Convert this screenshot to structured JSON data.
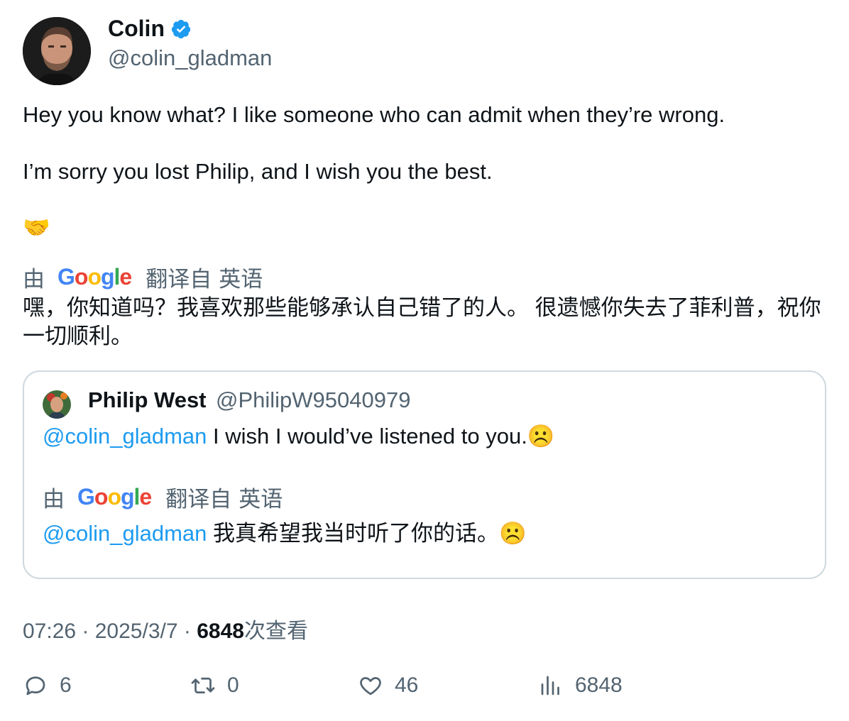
{
  "author": {
    "display_name": "Colin",
    "handle": "@colin_gladman",
    "verified": true
  },
  "tweet": {
    "text": "Hey you know what? I like someone who can admit when they’re wrong.\n\nI’m sorry you lost Philip, and I wish you the best.",
    "emoji": "🤝",
    "translation_prefix": "由",
    "translation_provider": "Google",
    "translation_label": "翻译自",
    "translation_language": "英语",
    "translated_text": "嘿，你知道吗？我喜欢那些能够承认自己错了的人。 很遗憾你失去了菲利普，祝你一切顺利。"
  },
  "quoted_tweet": {
    "display_name": "Philip West",
    "handle": "@PhilipW95040979",
    "mention": "@colin_gladman",
    "text": " I wish I would’ve listened to you.☹️",
    "translation_prefix": "由",
    "translation_provider": "Google",
    "translation_label": "翻译自",
    "translation_language": "英语",
    "translated_mention": "@colin_gladman",
    "translated_text": " 我真希望我当时听了你的话。☹️"
  },
  "meta": {
    "time": "07:26",
    "separator": " · ",
    "date": "2025/3/7",
    "views": "6848",
    "views_label": "次查看"
  },
  "actions": {
    "replies": "6",
    "retweets": "0",
    "likes": "46",
    "views": "6848"
  },
  "colors": {
    "accent": "#1d9bf0",
    "text": "#0f1419",
    "secondary": "#536471",
    "border": "#cfd9de"
  }
}
